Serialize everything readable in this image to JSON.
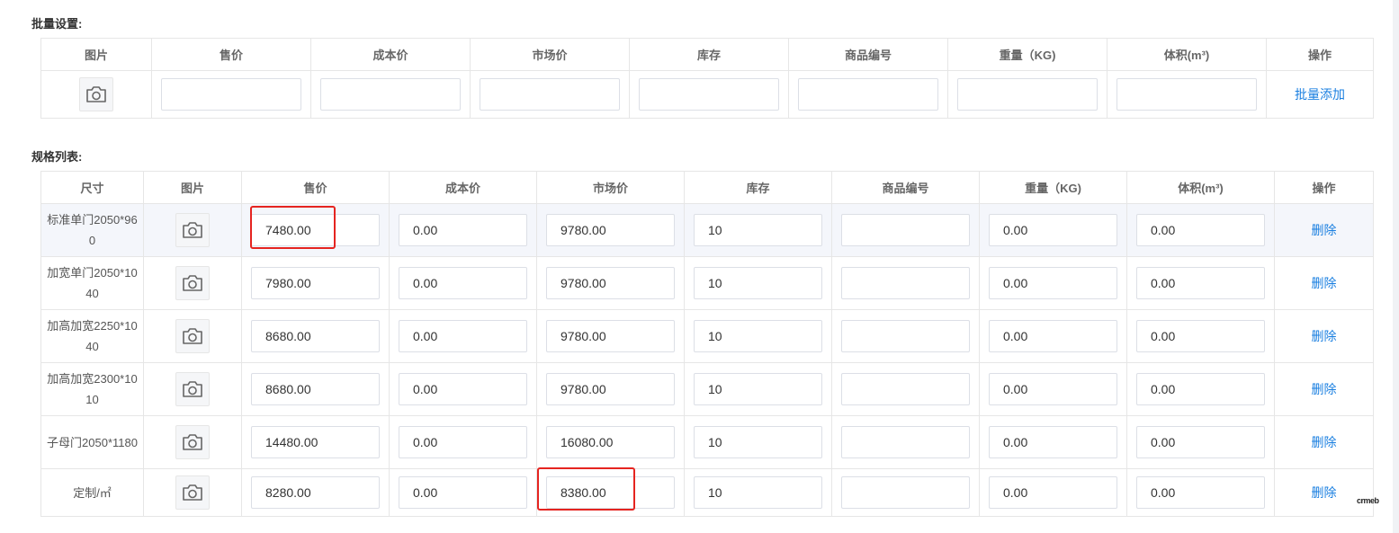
{
  "batch": {
    "title": "批量设置:",
    "headers": [
      "图片",
      "售价",
      "成本价",
      "市场价",
      "库存",
      "商品编号",
      "重量（KG)",
      "体积(m³)",
      "操作"
    ],
    "action_label": "批量添加",
    "icon": "camera-icon"
  },
  "specs": {
    "title": "规格列表:",
    "headers": [
      "尺寸",
      "图片",
      "售价",
      "成本价",
      "市场价",
      "库存",
      "商品编号",
      "重量（KG)",
      "体积(m³)",
      "操作"
    ],
    "delete_label": "删除",
    "rows": [
      {
        "size": "标准单门2050*960",
        "price": "7480.00",
        "cost": "0.00",
        "market": "9780.00",
        "stock": "10",
        "code": "",
        "weight": "0.00",
        "volume": "0.00"
      },
      {
        "size": "加宽单门2050*1040",
        "price": "7980.00",
        "cost": "0.00",
        "market": "9780.00",
        "stock": "10",
        "code": "",
        "weight": "0.00",
        "volume": "0.00"
      },
      {
        "size": "加高加宽2250*1040",
        "price": "8680.00",
        "cost": "0.00",
        "market": "9780.00",
        "stock": "10",
        "code": "",
        "weight": "0.00",
        "volume": "0.00"
      },
      {
        "size": "加高加宽2300*1010",
        "price": "8680.00",
        "cost": "0.00",
        "market": "9780.00",
        "stock": "10",
        "code": "",
        "weight": "0.00",
        "volume": "0.00"
      },
      {
        "size": "子母门2050*1180",
        "price": "14480.00",
        "cost": "0.00",
        "market": "16080.00",
        "stock": "10",
        "code": "",
        "weight": "0.00",
        "volume": "0.00"
      },
      {
        "size": "定制/㎡",
        "price": "8280.00",
        "cost": "0.00",
        "market": "8380.00",
        "stock": "10",
        "code": "",
        "weight": "0.00",
        "volume": "0.00"
      }
    ]
  },
  "watermark": "crmeb",
  "colors": {
    "link": "#1a7fe0",
    "highlight": "#e52420",
    "border": "#e6e6e6"
  }
}
